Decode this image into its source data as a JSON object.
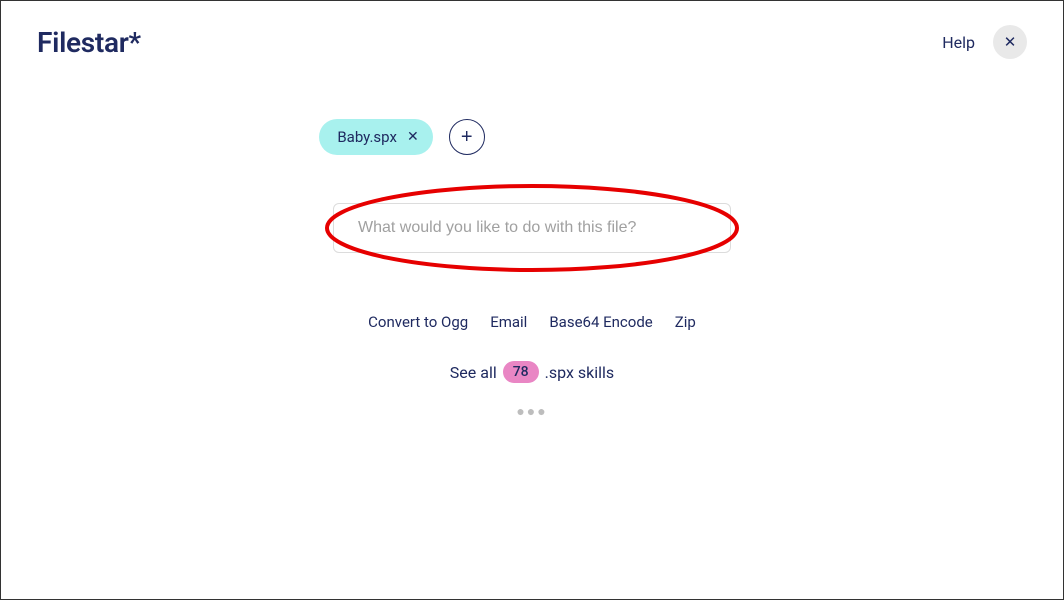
{
  "header": {
    "logo": "Filestar*",
    "help": "Help"
  },
  "file": {
    "name": "Baby.spx"
  },
  "search": {
    "placeholder": "What would you like to do with this file?"
  },
  "suggestions": [
    "Convert to Ogg",
    "Email",
    "Base64 Encode",
    "Zip"
  ],
  "see_all": {
    "prefix": "See all",
    "count": "78",
    "suffix": ".spx skills"
  }
}
